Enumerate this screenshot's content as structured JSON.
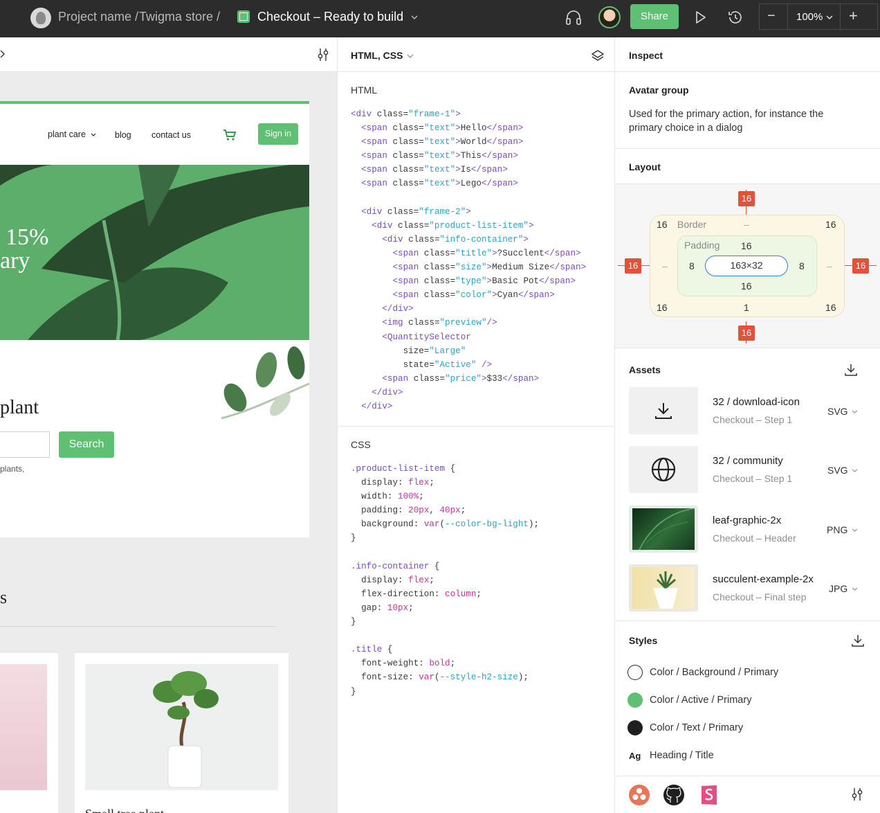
{
  "topbar": {
    "crumb_project": "Project name /",
    "crumb_store": "Twigma store /",
    "file_title": "Checkout – Ready to build",
    "share_label": "Share",
    "zoom_value": "100%",
    "zoom_minus": "−",
    "zoom_plus": "+"
  },
  "preview": {
    "nav": [
      "plant care",
      "blog",
      "contact us"
    ],
    "signin_label": "Sign in",
    "hero_line1": "15%",
    "hero_line2": "ary",
    "heading_plant": "plant",
    "search_label": "Search",
    "hint_text": "plants,",
    "section_letter": "s",
    "card_title": "Small tree plant"
  },
  "code_panel": {
    "lang_label": "HTML, CSS",
    "html_title": "HTML",
    "css_title": "CSS"
  },
  "inspect": {
    "title": "Inspect",
    "component_name": "Avatar group",
    "description": "Used for the primary action, for instance the primary choice in a dialog",
    "layout_title": "Layout",
    "layout": {
      "margin_top": "16",
      "margin_bottom": "16",
      "margin_left": "16",
      "margin_right": "16",
      "border_label": "Border",
      "border_top": "–",
      "border_left": "–",
      "border_right": "–",
      "border_bottom": "1",
      "radius_tl": "16",
      "radius_tr": "16",
      "radius_bl": "16",
      "radius_br": "16",
      "padding_label": "Padding",
      "padding_top": "16",
      "padding_left": "8",
      "padding_right": "8",
      "padding_bottom": "16",
      "size": "163×32"
    },
    "assets_title": "Assets",
    "assets": [
      {
        "name": "32 / download-icon",
        "sub": "Checkout – Step 1",
        "format": "SVG"
      },
      {
        "name": "32 / community",
        "sub": "Checkout – Step 1",
        "format": "SVG"
      },
      {
        "name": "leaf-graphic-2x",
        "sub": "Checkout – Header",
        "format": "PNG"
      },
      {
        "name": "succulent-example-2x",
        "sub": "Checkout – Final step",
        "format": "JPG"
      }
    ],
    "styles_title": "Styles",
    "styles": [
      {
        "label": "Color / Background / Primary",
        "color": "#ffffff"
      },
      {
        "label": "Color / Active / Primary",
        "color": "#5fbf73"
      },
      {
        "label": "Color / Text / Primary",
        "color": "#1f1f1f"
      },
      {
        "label": "Heading / Title",
        "glyph": "Ag"
      }
    ]
  },
  "colors": {
    "accent": "#5fbf73",
    "tag": "#e0533a",
    "topbar": "#2c2c2c"
  }
}
